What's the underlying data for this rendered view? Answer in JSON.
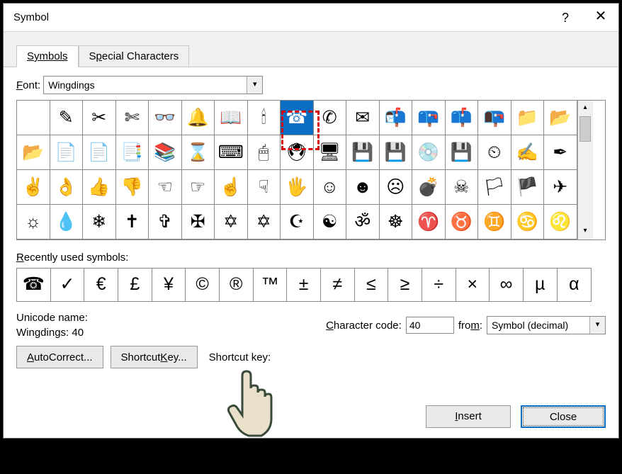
{
  "title": "Symbol",
  "tabs": {
    "symbols": "Symbols",
    "special": "Special Characters"
  },
  "font_label": "Font:",
  "font_value": "Wingdings",
  "grid": [
    [
      " ",
      "✎",
      "✂",
      "✄",
      "👓",
      "🔔",
      "📖",
      "🕯",
      "☎",
      "✆",
      "✉",
      "📬",
      "📪",
      "📫",
      "📭",
      "📁",
      "📂"
    ],
    [
      "📂",
      "📄",
      "📄",
      "📑",
      "📚",
      "⌛",
      "⌨",
      "🖱",
      "🖲",
      "🖥",
      "💾",
      "💾",
      "💿",
      "💾",
      "⏲",
      "✍",
      "✒"
    ],
    [
      "✌",
      "👌",
      "👍",
      "👎",
      "☜",
      "☞",
      "☝",
      "☟",
      "🖐",
      "☺",
      "☻",
      "☹",
      "💣",
      "☠",
      "🏳",
      "🏴",
      "✈"
    ],
    [
      "☼",
      "💧",
      "❄",
      "✝",
      "✞",
      "✠",
      "✡",
      "✡",
      "☪",
      "☯",
      "ॐ",
      "☸",
      "♈",
      "♉",
      "♊",
      "♋",
      "♌"
    ]
  ],
  "grid_alt": [
    [
      " ",
      "pencil",
      "scissors",
      "scissors-cut",
      "glasses",
      "bell",
      "book-open",
      "candle",
      "telephone",
      "telephone-circle",
      "envelope",
      "mailbox-1",
      "mailbox-2",
      "mailbox-3",
      "mailbox-4",
      "folder",
      "folder-open"
    ],
    [
      "folder-open",
      "document",
      "document",
      "documents",
      "filing-cabinet",
      "hourglass",
      "keyboard",
      "mouse",
      "trackball",
      "computer",
      "floppy",
      "floppy-2",
      "disc",
      "save",
      "clock",
      "writing-hand",
      "pen"
    ],
    [
      "victory",
      "ok-hand",
      "thumbs-up",
      "thumbs-down",
      "point-left",
      "point-right",
      "point-up",
      "point-down",
      "hand",
      "smile",
      "face",
      "frown",
      "bomb",
      "skull",
      "flag",
      "flag-2",
      "airplane"
    ],
    [
      "sun",
      "droplet",
      "snowflake",
      "cross",
      "cross-2",
      "maltese",
      "star-david",
      "star-david-2",
      "crescent",
      "yinyang",
      "om",
      "wheel",
      "aries",
      "taurus",
      "gemini",
      "cancer",
      "leo"
    ]
  ],
  "selected_row": 0,
  "selected_col": 8,
  "recent_label": "Recently used symbols:",
  "recent": [
    "☎",
    "✓",
    "€",
    "£",
    "¥",
    "©",
    "®",
    "™",
    "±",
    "≠",
    "≤",
    "≥",
    "÷",
    "×",
    "∞",
    "µ",
    "α"
  ],
  "unicode_label": "Unicode name:",
  "unicode_value": "Wingdings: 40",
  "ccode_label": "Character code:",
  "ccode_value": "40",
  "from_label": "from:",
  "from_value": "Symbol (decimal)",
  "autocorrect": "AutoCorrect...",
  "shortcut_btn": "Shortcut Key...",
  "shortcut_label": "Shortcut key:",
  "insert": "Insert",
  "close": "Close"
}
